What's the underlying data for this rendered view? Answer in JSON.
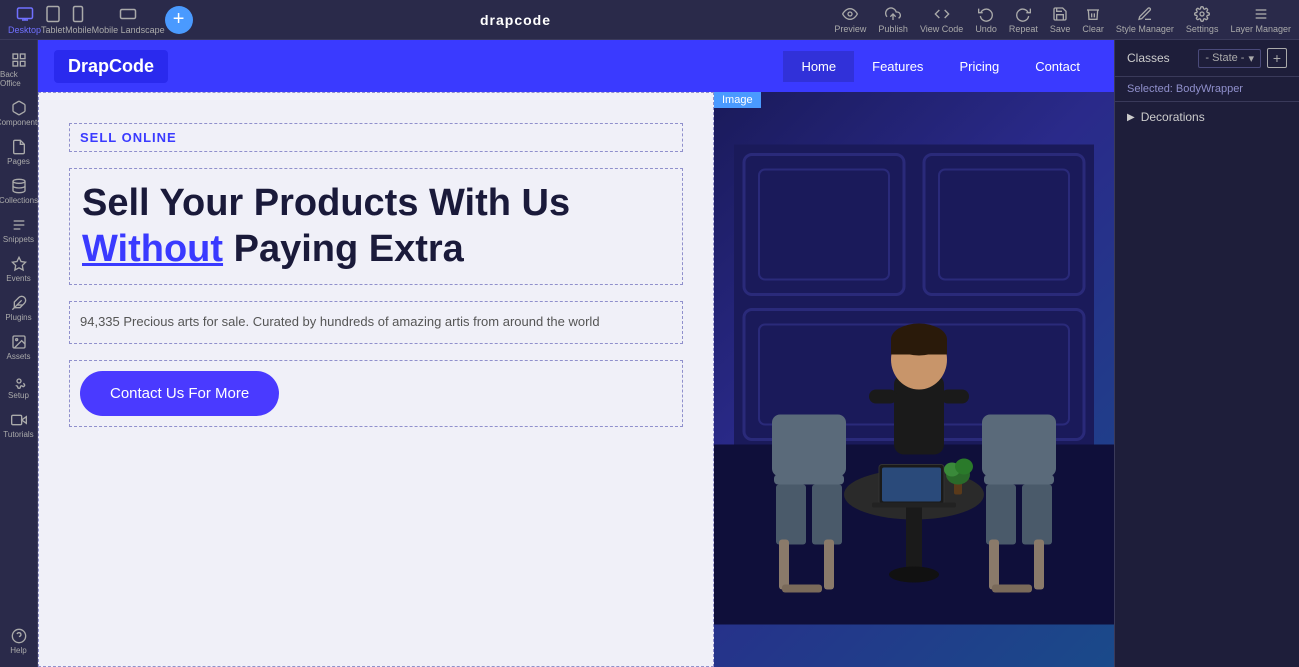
{
  "toolbar": {
    "brand": "drapcode",
    "devices": [
      {
        "label": "Desktop",
        "icon": "desktop"
      },
      {
        "label": "Tablet",
        "icon": "tablet"
      },
      {
        "label": "Mobile",
        "icon": "mobile"
      },
      {
        "label": "Mobile Landscape",
        "icon": "mobile-landscape"
      }
    ],
    "add_button": "+",
    "actions": [
      {
        "label": "Preview",
        "icon": "eye"
      },
      {
        "label": "Publish",
        "icon": "upload"
      },
      {
        "label": "View Code",
        "icon": "code"
      },
      {
        "label": "Undo",
        "icon": "undo"
      },
      {
        "label": "Repeat",
        "icon": "repeat"
      },
      {
        "label": "Save",
        "icon": "save"
      },
      {
        "label": "Clear",
        "icon": "trash"
      },
      {
        "label": "Style Manager",
        "icon": "style"
      },
      {
        "label": "Settings",
        "icon": "settings"
      },
      {
        "label": "Layer Manager",
        "icon": "layers"
      }
    ]
  },
  "sidebar": {
    "items": [
      {
        "label": "Back Office",
        "icon": "back"
      },
      {
        "label": "Components",
        "icon": "components"
      },
      {
        "label": "Pages",
        "icon": "pages"
      },
      {
        "label": "Collections",
        "icon": "collections"
      },
      {
        "label": "Snippets",
        "icon": "snippets"
      },
      {
        "label": "Events",
        "icon": "events"
      },
      {
        "label": "Plugins",
        "icon": "plugins"
      },
      {
        "label": "Assets",
        "icon": "assets"
      },
      {
        "label": "Setup",
        "icon": "setup"
      },
      {
        "label": "Tutorials",
        "icon": "tutorials"
      },
      {
        "label": "Help",
        "icon": "help"
      }
    ]
  },
  "nav": {
    "brand": "DrapCode",
    "links": [
      "Home",
      "Features",
      "Pricing",
      "Contact"
    ]
  },
  "hero": {
    "sell_online": "SELL ONLINE",
    "headline_part1": "Sell Your Products With Us ",
    "headline_link": "Without",
    "headline_part2": " Paying Extra",
    "description": "94,335 Precious arts for sale. Curated by hundreds of amazing artis from around the world",
    "cta_button": "Contact Us For More"
  },
  "image_label": "Image",
  "right_panel": {
    "title": "Classes",
    "add_button": "+",
    "state_label": "- State -",
    "selected": "Selected: BodyWrapper",
    "decorations_label": "Decorations"
  }
}
